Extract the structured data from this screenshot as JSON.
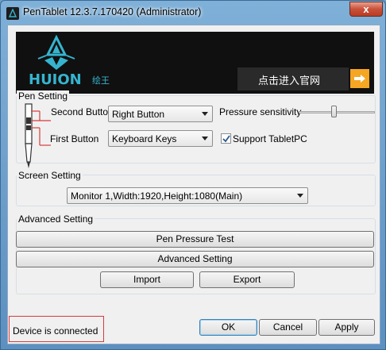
{
  "window": {
    "title": "PenTablet 12.3.7.170420 (Administrator)",
    "close_label": "x"
  },
  "banner": {
    "logo_text": "HUION",
    "logo_cn": "绘王",
    "website_label": "点击进入官网",
    "accent_color": "#f5a623",
    "brand_color": "#36b4cf"
  },
  "pen_setting": {
    "title": "Pen Setting",
    "second_button_label": "Second Button",
    "second_button_value": "Right Button",
    "first_button_label": "First Button",
    "first_button_value": "Keyboard Keys",
    "pressure_label": "Pressure sensitivity",
    "pressure_value": 0.46,
    "support_tabletpc_label": "Support TabletPC",
    "support_tabletpc_checked": true
  },
  "screen_setting": {
    "title": "Screen Setting",
    "monitor_value": "Monitor 1,Width:1920,Height:1080(Main)"
  },
  "advanced_setting": {
    "title": "Advanced Setting",
    "pen_pressure_test_label": "Pen Pressure Test",
    "advanced_setting_label": "Advanced Setting",
    "import_label": "Import",
    "export_label": "Export"
  },
  "footer": {
    "status_text": "Device is connected",
    "ok_label": "OK",
    "cancel_label": "Cancel",
    "apply_label": "Apply"
  }
}
